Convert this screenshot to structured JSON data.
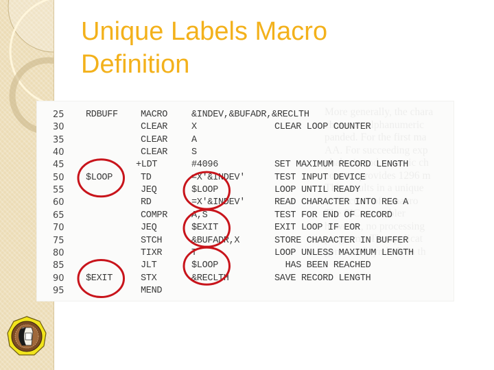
{
  "slide": {
    "title_line1": "Unique Labels Macro",
    "title_line2": "Definition"
  },
  "code_listing": {
    "rows": [
      {
        "line": "25",
        "label": "RDBUFF",
        "opcode": "MACRO",
        "operand": "&INDEV,&BUFADR,&RECLTH",
        "comment": ""
      },
      {
        "line": "30",
        "label": "",
        "opcode": "CLEAR",
        "operand": "X",
        "comment": "CLEAR LOOP COUNTER"
      },
      {
        "line": "35",
        "label": "",
        "opcode": "CLEAR",
        "operand": "A",
        "comment": ""
      },
      {
        "line": "40",
        "label": "",
        "opcode": "CLEAR",
        "operand": "S",
        "comment": ""
      },
      {
        "line": "45",
        "label": "",
        "opcode": "+LDT",
        "operand": "#4096",
        "comment": "SET MAXIMUM RECORD LENGTH"
      },
      {
        "line": "50",
        "label": "$LOOP",
        "opcode": "TD",
        "operand": "=X'&INDEV'",
        "comment": "TEST INPUT DEVICE"
      },
      {
        "line": "55",
        "label": "",
        "opcode": "JEQ",
        "operand": "$LOOP",
        "comment": "LOOP UNTIL READY"
      },
      {
        "line": "60",
        "label": "",
        "opcode": "RD",
        "operand": "=X'&INDEV'",
        "comment": "READ CHARACTER INTO REG A"
      },
      {
        "line": "65",
        "label": "",
        "opcode": "COMPR",
        "operand": "A,S",
        "comment": "TEST FOR END OF RECORD"
      },
      {
        "line": "70",
        "label": "",
        "opcode": "JEQ",
        "operand": "$EXIT",
        "comment": "EXIT LOOP IF EOR"
      },
      {
        "line": "75",
        "label": "",
        "opcode": "STCH",
        "operand": "&BUFADR,X",
        "comment": "STORE CHARACTER IN BUFFER"
      },
      {
        "line": "80",
        "label": "",
        "opcode": "TIXR",
        "operand": "T",
        "comment": "LOOP UNLESS MAXIMUM LENGTH"
      },
      {
        "line": "85",
        "label": "",
        "opcode": "JLT",
        "operand": "$LOOP",
        "comment": "  HAS BEEN REACHED"
      },
      {
        "line": "90",
        "label": "$EXIT",
        "opcode": "STX",
        "operand": "&RECLTH",
        "comment": "SAVE RECORD LENGTH"
      },
      {
        "line": "95",
        "label": "",
        "opcode": "MEND",
        "operand": "",
        "comment": ""
      }
    ],
    "highlights": [
      {
        "row": 5,
        "column": "label",
        "text": "$LOOP"
      },
      {
        "row": 6,
        "column": "operand",
        "text": "$LOOP"
      },
      {
        "row": 9,
        "column": "operand",
        "text": "$EXIT"
      },
      {
        "row": 12,
        "column": "operand",
        "text": "$LOOP"
      },
      {
        "row": 13,
        "column": "label",
        "text": "$EXIT"
      }
    ],
    "highlight_color": "#c8141b"
  },
  "bleed_through_text": [
    "More generally, the chara",
    "character alphanumeric",
    "panded. For the first ma",
    "AA. For succeeding exp",
    "phabetic and numeric ch",
    "counter provides 1296 m",
    "This results in a unique",
    "instruction of a macro",
    "The SIC assembler",
    "however, no processing",
    "programs. The applicat",
    "generated symbols in th"
  ],
  "theme": {
    "title_color": "#f3b11b",
    "sidebar_color": "#ecdcb6"
  },
  "logo": {
    "name": "university-seal-logo"
  }
}
